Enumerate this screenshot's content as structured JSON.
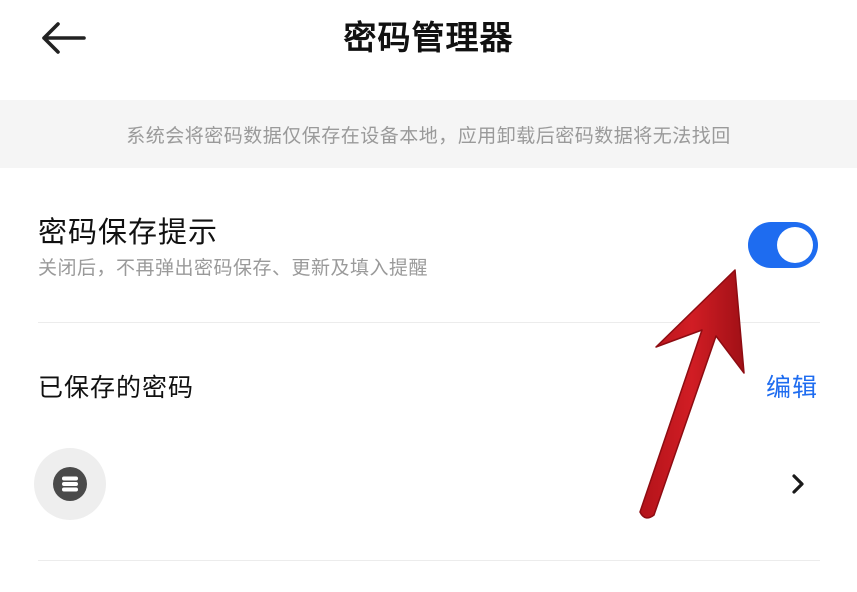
{
  "header": {
    "title": "密码管理器",
    "back_icon": "arrow-left-icon"
  },
  "notice": {
    "text": "系统会将密码数据仅保存在设备本地，应用卸载后密码数据将无法找回"
  },
  "save_prompt_setting": {
    "title": "密码保存提示",
    "subtitle": "关闭后，不再弹出密码保存、更新及填入提醒",
    "enabled": true
  },
  "saved_passwords": {
    "title": "已保存的密码",
    "edit_label": "编辑",
    "entries": [
      {
        "icon": "site-logo-icon",
        "chevron": "chevron-right-icon"
      }
    ]
  },
  "colors": {
    "accent": "#1e6cf0",
    "annotation_arrow": "#c8161d",
    "notice_bg": "#f5f5f5"
  }
}
